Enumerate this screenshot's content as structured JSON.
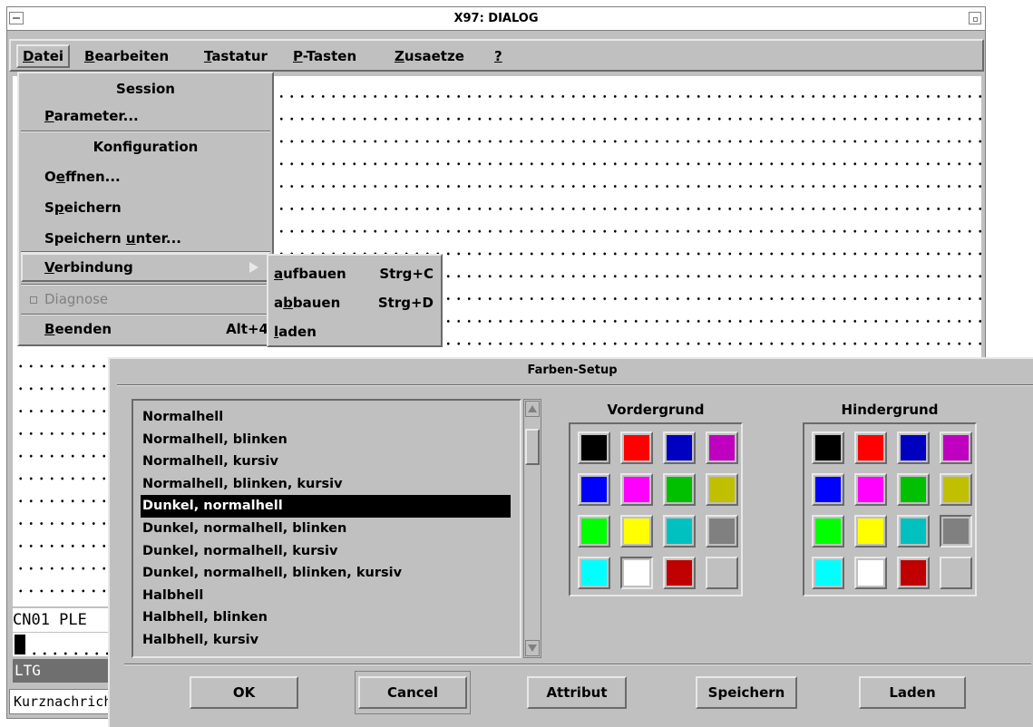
{
  "window": {
    "title": "X97: DIALOG"
  },
  "menubar": {
    "items": [
      {
        "label": "Datei",
        "mnemonic": "D"
      },
      {
        "label": "Bearbeiten",
        "mnemonic": "B"
      },
      {
        "label": "Tastatur",
        "mnemonic": "T"
      },
      {
        "label": "P-Tasten",
        "mnemonic": "P"
      },
      {
        "label": "Zusaetze",
        "mnemonic": "Z"
      },
      {
        "label": "?",
        "mnemonic": "?"
      }
    ]
  },
  "datei_menu": {
    "session_heading": "Session",
    "parameter": "Parameter...",
    "konfiguration_heading": "Konfiguration",
    "oeffnen": "Oeffnen...",
    "speichern": "Speichern",
    "speichern_unter": "Speichern unter...",
    "verbindung": "Verbindung",
    "diagnose": "Diagnose",
    "beenden": "Beenden",
    "beenden_accel": "Alt+4"
  },
  "verbindung_submenu": [
    {
      "label": "aufbauen",
      "accel": "Strg+C"
    },
    {
      "label": "abbauen",
      "accel": "Strg+D"
    },
    {
      "label": "laden",
      "accel": ""
    }
  ],
  "terminal": {
    "status_line": "CN01 PLE",
    "ltg_label": "LTG",
    "kurznachricht": "Kurznachricht"
  },
  "farben_dialog": {
    "title": "Farben-Setup",
    "attributes": [
      "Normalhell",
      "Normalhell, blinken",
      "Normalhell, kursiv",
      "Normalhell, blinken, kursiv",
      "Dunkel, normalhell",
      "Dunkel, normalhell, blinken",
      "Dunkel, normalhell, kursiv",
      "Dunkel, normalhell, blinken, kursiv",
      "Halbhell",
      "Halbhell, blinken",
      "Halbhell, kursiv"
    ],
    "selected_index": 4,
    "vordergrund_label": "Vordergrund",
    "hintergrund_label": "Hindergrund",
    "palette": [
      "#000000",
      "#ff0000",
      "#0000c0",
      "#c000c0",
      "#0000ff",
      "#ff00ff",
      "#00c000",
      "#c0c000",
      "#00ff00",
      "#ffff00",
      "#00c0c0",
      "#808080",
      "#00ffff",
      "#ffffff",
      "#c00000",
      "#c0c0c0"
    ],
    "vordergrund_selected_index": 13,
    "hintergrund_selected_index": 11,
    "buttons": {
      "ok": "OK",
      "cancel": "Cancel",
      "attribut": "Attribut",
      "speichern": "Speichern",
      "laden": "Laden"
    }
  }
}
